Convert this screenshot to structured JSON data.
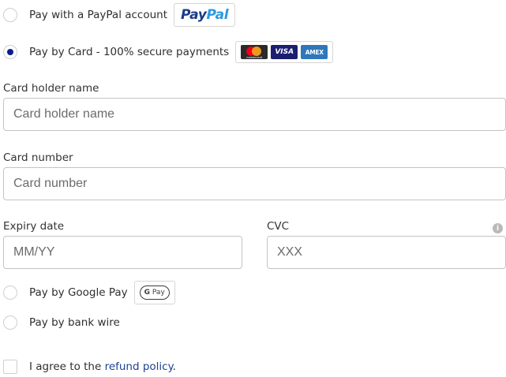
{
  "payment": {
    "paypal": {
      "label": "Pay with a PayPal account",
      "logo_part1": "Pay",
      "logo_part2": "Pal"
    },
    "card": {
      "label": "Pay by Card - 100% secure payments",
      "logos": {
        "mastercard": "mastercard",
        "visa": "VISA",
        "amex": "AMEX"
      }
    },
    "google_pay": {
      "label": "Pay by Google Pay",
      "logo_g": "G",
      "logo_pay": "Pay"
    },
    "bank_wire": {
      "label": "Pay by bank wire"
    },
    "selected": "card"
  },
  "form": {
    "card_holder": {
      "label": "Card holder name",
      "placeholder": "Card holder name"
    },
    "card_number": {
      "label": "Card number",
      "placeholder": "Card number"
    },
    "expiry": {
      "label": "Expiry date",
      "placeholder": "MM/YY"
    },
    "cvc": {
      "label": "CVC",
      "placeholder": "XXX",
      "info_icon": "info-icon"
    }
  },
  "terms": {
    "prefix": "I agree to the ",
    "link": "refund policy",
    "suffix": "."
  },
  "colors": {
    "radio_selected": "#0d1c8a",
    "link": "#1f3f8f",
    "paypal_dark": "#1b3c86",
    "paypal_light": "#2b9ae0"
  }
}
